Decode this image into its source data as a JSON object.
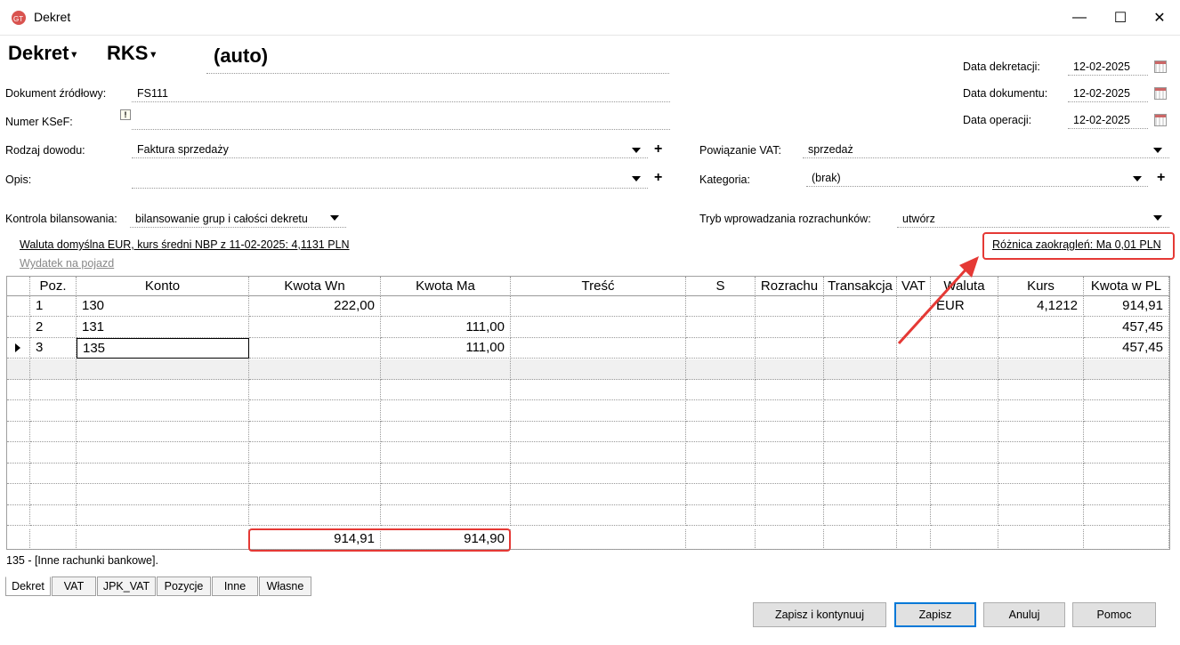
{
  "window": {
    "title": "Dekret",
    "minimize": "—",
    "maximize": "☐",
    "close": "✕"
  },
  "header": {
    "type": "Dekret",
    "journal": "RKS",
    "number": "(auto)"
  },
  "fields": {
    "doc_source_label": "Dokument źródłowy:",
    "doc_source_value": "FS111",
    "ksef_label": "Numer KSeF:",
    "ksef_value": "",
    "proof_type_label": "Rodzaj dowodu:",
    "proof_type_value": "Faktura sprzedaży",
    "desc_label": "Opis:",
    "desc_value": "",
    "balance_label": "Kontrola bilansowania:",
    "balance_value": "bilansowanie grup i całości dekretu",
    "currency_info": "Waluta domyślna EUR, kurs średni NBP z 11-02-2025: 4,1131 PLN",
    "vehicle_link": "Wydatek na pojazd",
    "vat_link_label": "Powiązanie VAT:",
    "vat_link_value": "sprzedaż",
    "category_label": "Kategoria:",
    "category_value": "(brak)",
    "settlement_label": "Tryb wprowadzania rozrachunków:",
    "settlement_value": "utwórz",
    "rounding_diff": "Różnica zaokrągleń: Ma 0,01 PLN"
  },
  "dates": [
    {
      "label": "Data dekretacji:",
      "value": "12-02-2025"
    },
    {
      "label": "Data dokumentu:",
      "value": "12-02-2025"
    },
    {
      "label": "Data operacji:",
      "value": "12-02-2025"
    }
  ],
  "grid": {
    "columns": [
      "Poz.",
      "Konto",
      "Kwota Wn",
      "Kwota Ma",
      "Treść",
      "S",
      "Rozrachu",
      "Transakcja",
      "VAT",
      "Waluta",
      "Kurs",
      "Kwota w PL"
    ],
    "rows": [
      {
        "poz": "1",
        "konto": "130",
        "wn": "222,00",
        "ma": "",
        "waluta": "EUR",
        "kurs": "4,1212",
        "pln": "914,91"
      },
      {
        "poz": "2",
        "konto": "131",
        "wn": "",
        "ma": "111,00",
        "waluta": "",
        "kurs": "",
        "pln": "457,45"
      },
      {
        "poz": "3",
        "konto": "135",
        "wn": "",
        "ma": "111,00",
        "waluta": "",
        "kurs": "",
        "pln": "457,45"
      }
    ],
    "totals": {
      "wn": "914,91",
      "ma": "914,90"
    }
  },
  "status_text": "135 - [Inne rachunki bankowe].",
  "tabs": [
    "Dekret",
    "VAT",
    "JPK_VAT",
    "Pozycje",
    "Inne",
    "Własne"
  ],
  "buttons": {
    "save_continue": "Zapisz i kontynuuj",
    "save": "Zapisz",
    "cancel": "Anuluj",
    "help": "Pomoc"
  },
  "colors": {
    "highlight": "#e53935",
    "accent": "#0078d7"
  }
}
